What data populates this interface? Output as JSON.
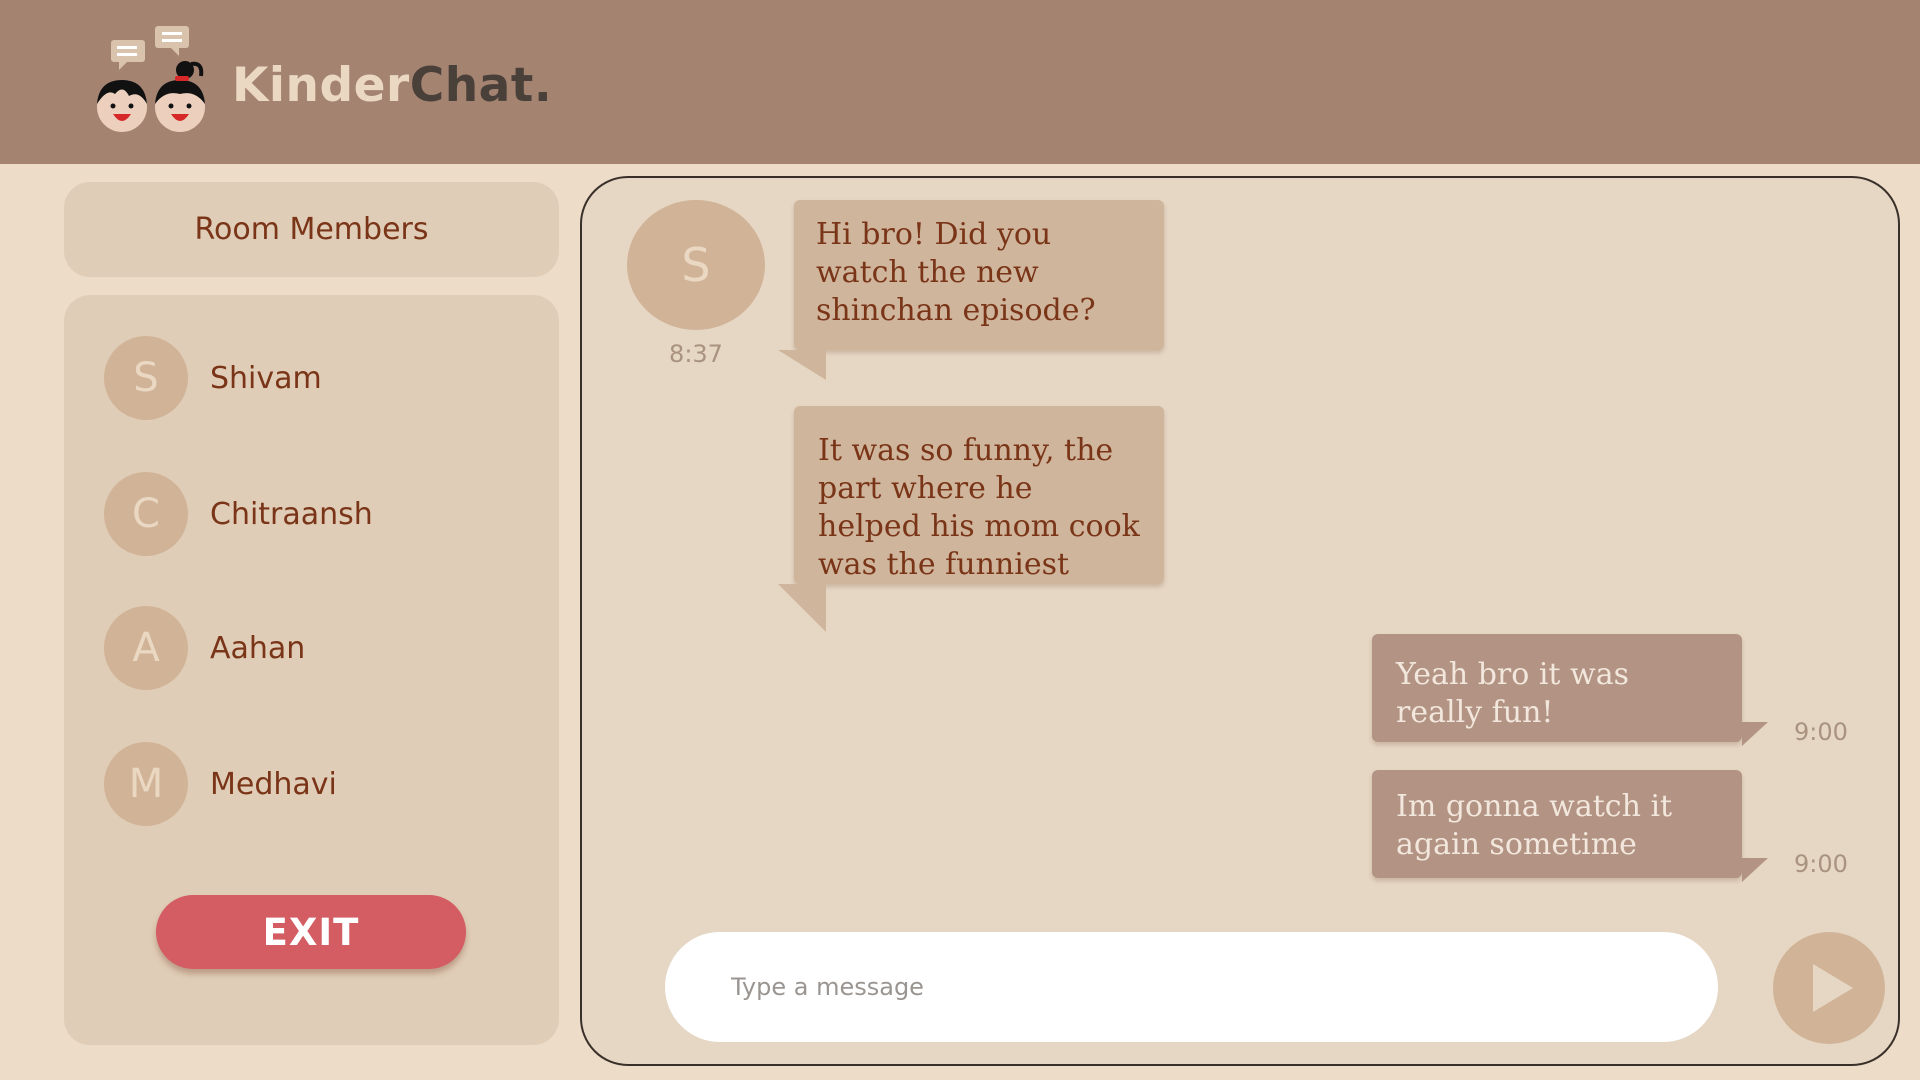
{
  "app": {
    "brand_part1": "Kinder",
    "brand_part2": "Chat."
  },
  "sidebar": {
    "title": "Room Members",
    "members": [
      {
        "initial": "S",
        "name": "Shivam"
      },
      {
        "initial": "C",
        "name": "Chitraansh"
      },
      {
        "initial": "A",
        "name": "Aahan"
      },
      {
        "initial": "M",
        "name": "Medhavi"
      }
    ],
    "exit_label": "EXIT"
  },
  "chat": {
    "sender_initial": "S",
    "sender_time": "8:37",
    "messages": [
      {
        "direction": "incoming",
        "text": "Hi bro! Did you watch the new shinchan episode?"
      },
      {
        "direction": "incoming",
        "text": "It was so funny, the part where he helped his mom cook was the funniest"
      },
      {
        "direction": "outgoing",
        "text": "Yeah bro it was really fun!",
        "time": "9:00"
      },
      {
        "direction": "outgoing",
        "text": "Im gonna watch it again sometime",
        "time": "9:00"
      }
    ],
    "input_placeholder": "Type a message",
    "input_value": ""
  },
  "icons": {
    "logo": "two-kids-chat-logo",
    "send": "send-play-icon"
  },
  "colors": {
    "header": "#a58371",
    "background": "#ecdcc8",
    "panel": "#e0cdb7",
    "incoming_bubble": "#cfb59b",
    "outgoing_bubble": "#b39484",
    "exit_button": "#d35d62",
    "text_brown": "#7a3518"
  }
}
